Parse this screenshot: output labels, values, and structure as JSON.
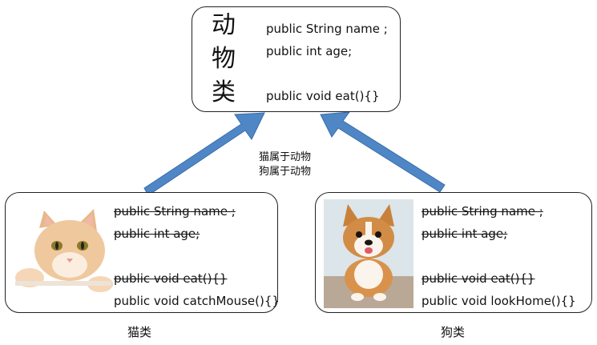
{
  "animal": {
    "chars": [
      "动",
      "物",
      "类"
    ],
    "fields": [
      "public String name ;",
      "public int age;"
    ],
    "method": "public void eat(){}"
  },
  "arrow_labels": [
    "猫属于动物",
    "狗属于动物"
  ],
  "cat": {
    "inherited_fields": [
      "public String name ;",
      "public int age;"
    ],
    "inherited_method": "public void eat(){}",
    "own_method": "public void catchMouse(){}",
    "caption": "猫类"
  },
  "dog": {
    "inherited_fields": [
      "public String name ;",
      "public int age;"
    ],
    "inherited_method": "public void eat(){}",
    "own_method": "public void lookHome(){}",
    "caption": "狗类"
  },
  "colors": {
    "arrow": "#4f86c6",
    "arrow_edge": "#3a6ea8"
  }
}
